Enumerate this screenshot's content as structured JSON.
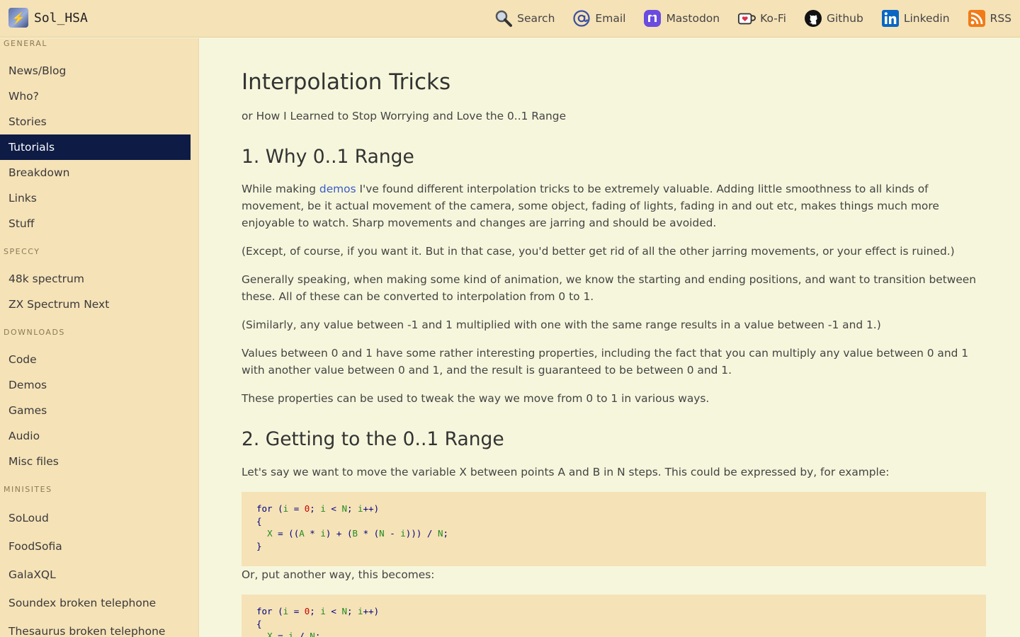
{
  "site": {
    "name": "Sol_HSA",
    "logo_icon": "lightning-logo-icon"
  },
  "topnav": [
    {
      "label": "Search",
      "icon": "search-icon"
    },
    {
      "label": "Email",
      "icon": "email-at-icon"
    },
    {
      "label": "Mastodon",
      "icon": "mastodon-icon"
    },
    {
      "label": "Ko-Fi",
      "icon": "kofi-cup-icon"
    },
    {
      "label": "Github",
      "icon": "github-icon"
    },
    {
      "label": "Linkedin",
      "icon": "linkedin-icon"
    },
    {
      "label": "RSS",
      "icon": "rss-icon"
    }
  ],
  "sidebar": {
    "sections": [
      "GENERAL",
      "SPECCY",
      "DOWNLOADS",
      "MINISITES"
    ],
    "items": [
      "News/Blog",
      "Who?",
      "Stories",
      "Tutorials",
      "Breakdown",
      "Links",
      "Stuff",
      "48k spectrum",
      "ZX Spectrum Next",
      "Code",
      "Demos",
      "Games",
      "Audio",
      "Misc files",
      "SoLoud",
      "FoodSofia",
      "GalaXQL",
      "Soundex broken telephone",
      "Thesaurus broken telephone"
    ],
    "active": "Tutorials"
  },
  "article": {
    "title": "Interpolation Tricks",
    "subtitle": "or How I Learned to Stop Worrying and Love the 0..1 Range",
    "h_why": "1. Why 0..1 Range",
    "p1_pre": "While making ",
    "p1_link": "demos",
    "p1_post": " I've found different interpolation tricks to be extremely valuable. Adding little smoothness to all kinds of movement, be it actual movement of the camera, some object, fading of lights, fading in and out etc, makes things much more enjoyable to watch. Sharp movements and changes are jarring and should be avoided.",
    "p2": "(Except, of course, if you want it. But in that case, you'd better get rid of all the other jarring movements, or your effect is ruined.)",
    "p3": "Generally speaking, when making some kind of animation, we know the starting and ending positions, and want to transition between these. All of these can be converted to interpolation from 0 to 1.",
    "p4": "(Similarly, any value between -1 and 1 multiplied with one with the same range results in a value between -1 and 1.)",
    "p5": "Values between 0 and 1 have some rather interesting properties, including the fact that you can multiply any value between 0 and 1 with another value between 0 and 1, and the result is guaranteed to be between 0 and 1.",
    "p6": "These properties can be used to tweak the way we move from 0 to 1 in various ways.",
    "h_getting": "2. Getting to the 0..1 Range",
    "p7": "Let's say we want to move the variable X between points A and B in N steps. This could be expressed by, for example:",
    "code1": [
      "for (i = 0; i < N; i++)",
      "{",
      "  X = ((A * i) + (B * (N - i))) / N;",
      "}"
    ],
    "p8": "Or, put another way, this becomes:",
    "code2": [
      "for (i = 0; i < N; i++)",
      "{",
      "  X = i / N;"
    ]
  }
}
